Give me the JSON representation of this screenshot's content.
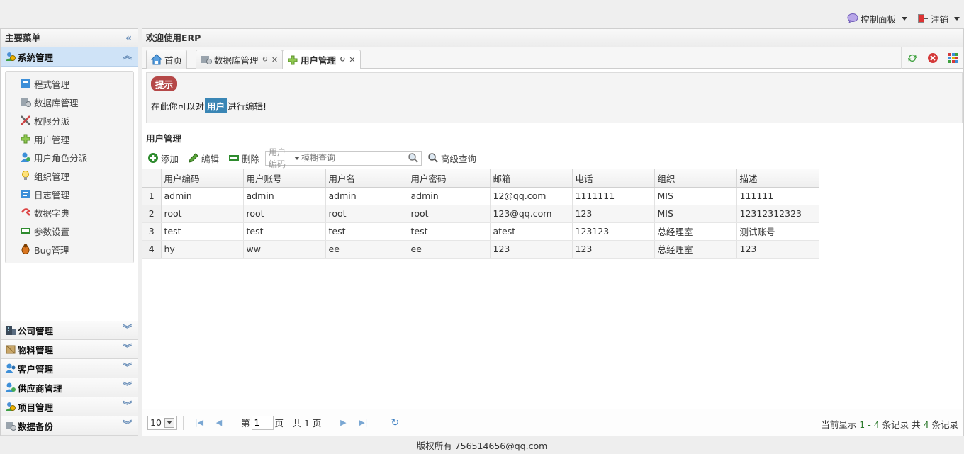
{
  "topbar": {
    "control_panel": "控制面板",
    "logout": "注销"
  },
  "west": {
    "title": "主要菜单",
    "active_section": "系统管理",
    "menu_items": [
      {
        "label": "程式管理",
        "icon": "program-icon"
      },
      {
        "label": "数据库管理",
        "icon": "database-icon"
      },
      {
        "label": "权限分派",
        "icon": "permission-icon"
      },
      {
        "label": "用户管理",
        "icon": "plus-icon"
      },
      {
        "label": "用户角色分派",
        "icon": "user-role-icon"
      },
      {
        "label": "组织管理",
        "icon": "bulb-icon"
      },
      {
        "label": "日志管理",
        "icon": "log-icon"
      },
      {
        "label": "数据字典",
        "icon": "dictionary-icon"
      },
      {
        "label": "参数设置",
        "icon": "parameter-icon"
      },
      {
        "label": "Bug管理",
        "icon": "bug-icon"
      }
    ],
    "sections": [
      {
        "label": "公司管理",
        "icon": "building-icon"
      },
      {
        "label": "物料管理",
        "icon": "material-icon"
      },
      {
        "label": "客户管理",
        "icon": "customer-icon"
      },
      {
        "label": "供应商管理",
        "icon": "supplier-icon"
      },
      {
        "label": "项目管理",
        "icon": "project-icon"
      },
      {
        "label": "数据备份",
        "icon": "backup-icon"
      }
    ]
  },
  "center": {
    "title": "欢迎使用ERP",
    "tabs": [
      {
        "label": "首页",
        "icon": "home-icon",
        "closable": false
      },
      {
        "label": "数据库管理",
        "icon": "database-icon",
        "closable": true
      },
      {
        "label": "用户管理",
        "icon": "plus-icon",
        "closable": true
      }
    ],
    "notice": {
      "badge": "提示",
      "text_before": "在此你可以对",
      "highlight": "用户",
      "text_after": "进行编辑!"
    },
    "grid_title": "用户管理",
    "toolbar": {
      "add": "添加",
      "edit": "编辑",
      "delete": "删除",
      "field_select": "用户编码",
      "search_placeholder": "模糊查询",
      "advanced": "高级查询"
    },
    "columns": [
      "用户编码",
      "用户账号",
      "用户名",
      "用户密码",
      "邮箱",
      "电话",
      "组织",
      "描述"
    ],
    "rows": [
      [
        "1",
        "admin",
        "admin",
        "admin",
        "admin",
        "12@qq.com",
        "1111111",
        "MIS",
        "111111"
      ],
      [
        "2",
        "root",
        "root",
        "root",
        "root",
        "123@qq.com",
        "123",
        "MIS",
        "12312312323"
      ],
      [
        "3",
        "test",
        "test",
        "test",
        "test",
        "atest",
        "123123",
        "总经理室",
        "测试账号"
      ],
      [
        "4",
        "hy",
        "ww",
        "ee",
        "ee",
        "123",
        "123",
        "总经理室",
        "123"
      ]
    ],
    "pager": {
      "page_size": "10",
      "page_prefix": "第",
      "page_value": "1",
      "page_suffix": "页 - 共 1 页",
      "info_prefix": "当前显示 ",
      "info_from": "1",
      "info_dash": " - ",
      "info_to": "4",
      "info_mid": " 条记录 共 ",
      "info_total": "4",
      "info_suffix": " 条记录"
    }
  },
  "footer": "版权所有 756514656@qq.com"
}
